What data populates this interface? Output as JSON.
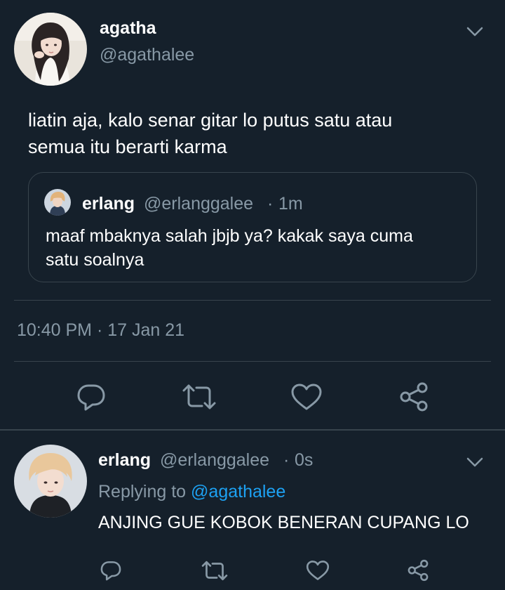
{
  "main_tweet": {
    "author": {
      "name": "agatha",
      "handle": "@agathalee"
    },
    "text_line1": "liatin aja, kalo senar gitar lo putus satu atau",
    "text_line2": "semua itu berarti karma",
    "quoted_tweet": {
      "name": "erlang",
      "handle": "@erlanggalee",
      "separator": "·",
      "time": "1m",
      "text_line1": "maaf mbaknya salah jbjb ya? kakak saya cuma",
      "text_line2": "satu soalnya"
    },
    "timestamp": "10:40 PM · 17 Jan 21"
  },
  "reply_tweet": {
    "author": {
      "name": "erlang",
      "handle": "@erlanggalee"
    },
    "separator": "·",
    "time": "0s",
    "replying_prefix": "Replying to",
    "replying_handle": "@agathalee",
    "text": "ANJING GUE KOBOK BENERAN CUPANG LO"
  },
  "icons": {
    "menu": "chevron-down-icon",
    "reply": "reply-icon",
    "retweet": "retweet-icon",
    "like": "heart-icon",
    "share": "share-icon"
  },
  "colors": {
    "background": "#15202b",
    "text": "#ffffff",
    "muted": "#8899a6",
    "border": "#38444d",
    "link": "#1da1f2"
  }
}
